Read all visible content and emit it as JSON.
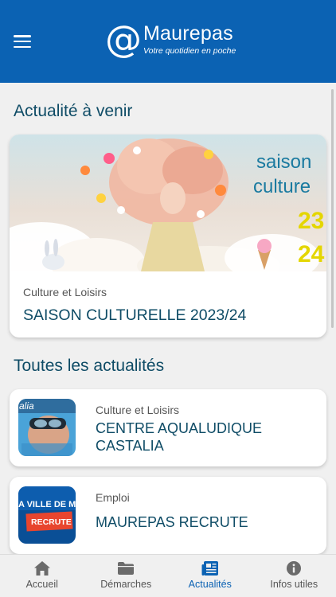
{
  "header": {
    "logo_at": "@",
    "logo_name": "Maurepas",
    "logo_tagline": "Votre quotidien en poche"
  },
  "upcoming": {
    "section_title": "Actualité à venir",
    "card": {
      "category": "Culture et Loisirs",
      "title": "SAISON CULTURELLE 2023/24",
      "image_text": [
        "saison",
        "culture",
        "23",
        "24"
      ]
    }
  },
  "all_news": {
    "section_title": "Toutes les actualités",
    "items": [
      {
        "category": "Culture et Loisirs",
        "title": "CENTRE AQUALUDIQUE CASTALIA",
        "thumb_text": "alia"
      },
      {
        "category": "Emploi",
        "title": "MAUREPAS RECRUTE",
        "thumb_text_top": "A VILLE DE MAU",
        "thumb_text_badge": "RECRUTE"
      }
    ]
  },
  "bottom_nav": {
    "items": [
      {
        "label": "Accueil",
        "icon": "home-icon",
        "active": false
      },
      {
        "label": "Démarches",
        "icon": "folder-icon",
        "active": false
      },
      {
        "label": "Actualités",
        "icon": "newspaper-icon",
        "active": true
      },
      {
        "label": "Infos utiles",
        "icon": "info-icon",
        "active": false
      }
    ]
  },
  "colors": {
    "header_bg": "#0b62b3",
    "title_text": "#0f4c66",
    "active_nav": "#0b62b3",
    "page_bg": "#f0f0f0"
  }
}
